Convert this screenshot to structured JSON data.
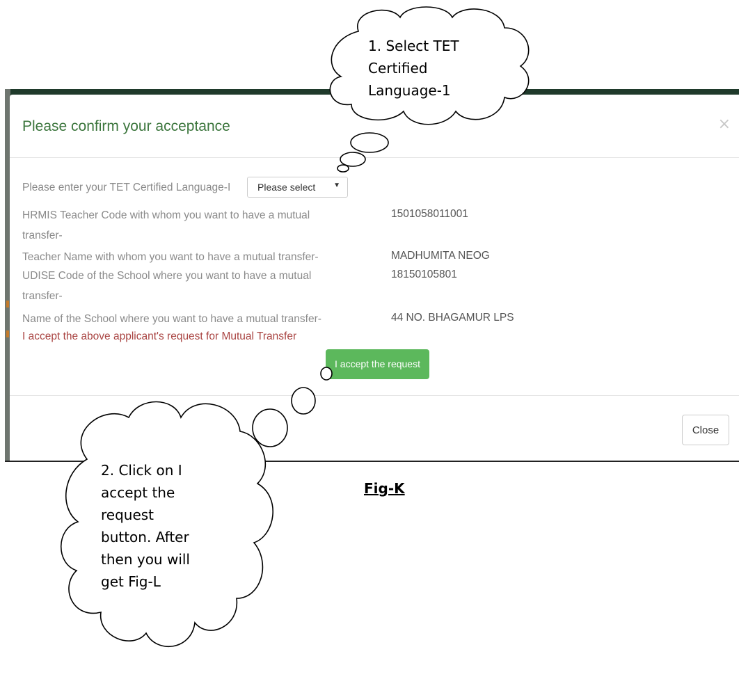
{
  "modal": {
    "title": "Please confirm your acceptance",
    "close_glyph": "×",
    "rows": [
      {
        "label": "Please enter your TET Certified Language-I"
      },
      {
        "label": "HRMIS Teacher Code with whom you want to have a mutual",
        "label_cont": "transfer-",
        "value": "1501058011001"
      },
      {
        "label": "Teacher Name with whom you want to have a mutual transfer-",
        "value": "MADHUMITA NEOG"
      },
      {
        "label": "UDISE Code of the School where you want to have a mutual",
        "label_cont": "transfer-",
        "value": "18150105801"
      },
      {
        "label": "Name of the School where you want to have a mutual transfer-",
        "value": "44 NO. BHAGAMUR LPS"
      }
    ],
    "language_select": {
      "selected": "Please select",
      "caret": "▼"
    },
    "accept_statement": "I accept the above applicant's request for Mutual Transfer",
    "accept_button": "I accept the request",
    "close_button": "Close"
  },
  "callouts": {
    "first": [
      "1. Select TET",
      "Certified",
      "Language-1"
    ],
    "second": [
      "2. Click on I",
      "accept the",
      "request",
      "button. After",
      "then you will",
      "get Fig-L"
    ]
  },
  "caption": "Fig-K",
  "colors": {
    "title": "#3c763d",
    "accept_statement": "#a94442",
    "accept_button": "#5cb85c",
    "header_bar": "#1f3a2b"
  }
}
